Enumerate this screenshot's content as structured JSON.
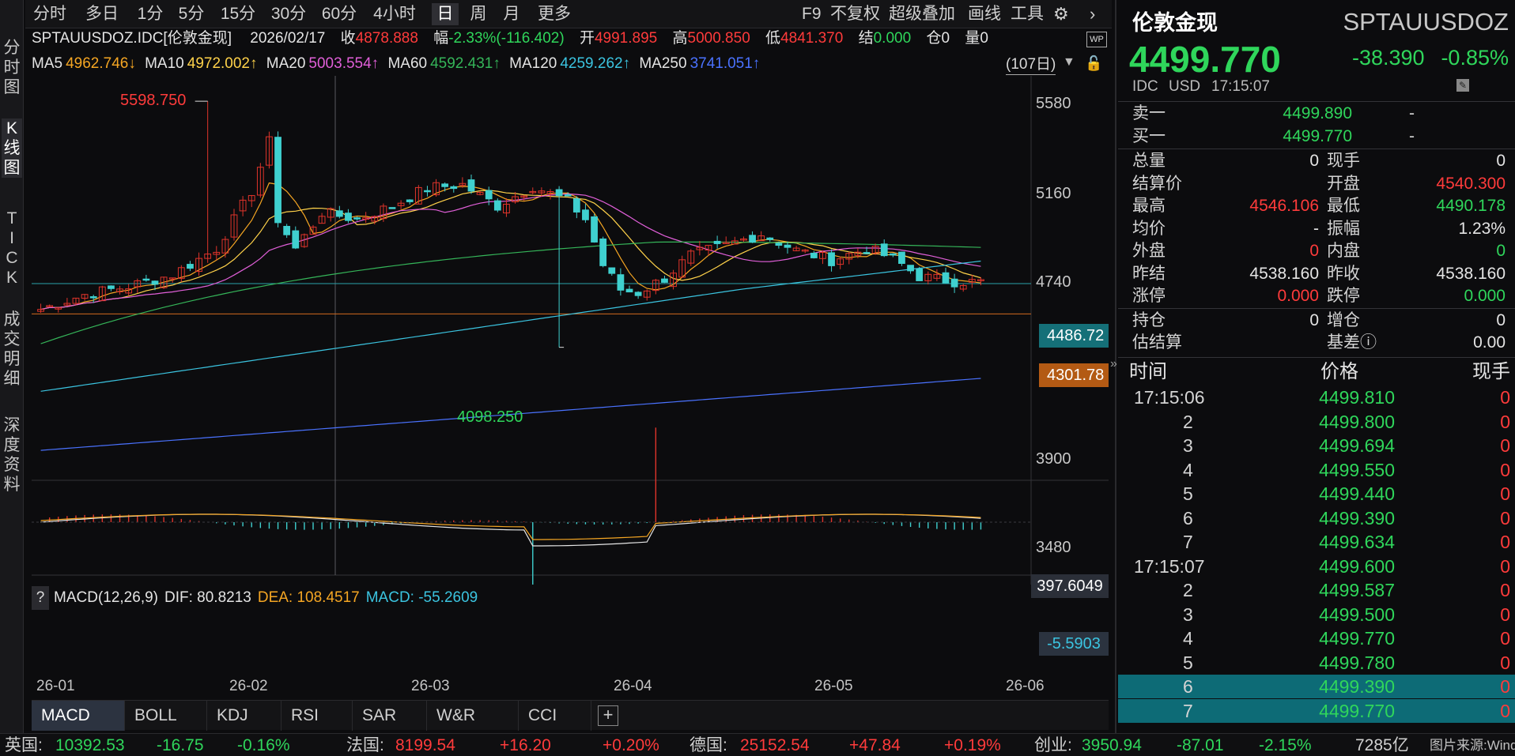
{
  "left_tabs": [
    "分\n时\n图",
    "K\n线\n图",
    "T\nI\nC\nK",
    "成\n交\n明\n细",
    "深\n度\n资\n料"
  ],
  "toolbar": {
    "periods": [
      "分时",
      "多日",
      "1分",
      "5分",
      "15分",
      "30分",
      "60分",
      "4小时",
      "日",
      "周",
      "月",
      "更多"
    ],
    "active_period": "日",
    "right": [
      "F9",
      "不复权",
      "超级叠加",
      "画线",
      "工具"
    ]
  },
  "info": {
    "symbol": "SPTAUUSDOZ.IDC[伦敦金现]",
    "date": "2026/02/17",
    "close_label": "收",
    "close": "4878.888",
    "chg_label": "幅",
    "chg": "-2.33%(-116.402)",
    "open_label": "开",
    "open": "4991.895",
    "high_label": "高",
    "high": "5000.850",
    "low_label": "低",
    "low": "4841.370",
    "settle_label": "结",
    "settle": "0.000",
    "oi_label": "仓",
    "oi": "0",
    "vol_label": "量",
    "vol": "0",
    "ma5": "MA5",
    "ma5_val": "4962.746↓",
    "ma10": "MA10",
    "ma10_val": "4972.002↑",
    "ma20": "MA20",
    "ma20_val": "5003.554↑",
    "ma60": "MA60",
    "ma60_val": "4592.431↑",
    "ma120": "MA120",
    "ma120_val": "4259.262↑",
    "ma250": "MA250",
    "ma250_val": "3741.051↑",
    "days": "(107日)"
  },
  "price_axis": [
    "5580",
    "5160",
    "4740",
    "3900",
    "3480"
  ],
  "annotations": {
    "high": "5598.750",
    "low": "4098.250"
  },
  "price_tags": {
    "current": "4486.72",
    "line": "4301.78"
  },
  "macd": {
    "help": "?",
    "name": "MACD(12,26,9)",
    "dif": "DIF: 80.8213",
    "dea": "DEA: 108.4517",
    "macd": "MACD: -55.2609",
    "axis_top": "397.6049",
    "last": "-5.5903"
  },
  "x_dates": [
    "26-01",
    "26-02",
    "26-03",
    "26-04",
    "26-05",
    "26-06"
  ],
  "indicator_tabs": [
    "MACD",
    "BOLL",
    "KDJ",
    "RSI",
    "SAR",
    "W&R",
    "CCI"
  ],
  "ticker": [
    {
      "text": "英国:",
      "color": "#d0d0d0"
    },
    {
      "text": "10392.53",
      "color": "#2fd65b"
    },
    {
      "text": "-16.75",
      "color": "#2fd65b"
    },
    {
      "text": "-0.16%",
      "color": "#2fd65b"
    },
    {
      "text": "法国:",
      "color": "#d0d0d0"
    },
    {
      "text": "8199.54",
      "color": "#ff3b3b"
    },
    {
      "text": "+16.20",
      "color": "#ff3b3b"
    },
    {
      "text": "+0.20%",
      "color": "#ff3b3b"
    },
    {
      "text": "德国:",
      "color": "#d0d0d0"
    },
    {
      "text": "25152.54",
      "color": "#ff3b3b"
    },
    {
      "text": "+47.84",
      "color": "#ff3b3b"
    },
    {
      "text": "+0.19%",
      "color": "#ff3b3b"
    },
    {
      "text": "创业:",
      "color": "#d0d0d0"
    },
    {
      "text": "3950.94",
      "color": "#2fd65b"
    },
    {
      "text": "-87.01",
      "color": "#2fd65b"
    },
    {
      "text": "-2.15%",
      "color": "#2fd65b"
    },
    {
      "text": "7285亿",
      "color": "#d0d0d0"
    },
    {
      "text": "图片来源:Wind",
      "color": "#c0c0c0"
    }
  ],
  "quote": {
    "name": "伦敦金现",
    "code": "SPTAUUSDOZ",
    "price": "4499.770",
    "chg": "-38.390",
    "pct": "-0.85%",
    "source": "IDC",
    "currency": "USD",
    "time": "17:15:07",
    "ask_label": "卖一",
    "ask": "4499.890",
    "ask_vol": "-",
    "bid_label": "买一",
    "bid": "4499.770",
    "bid_vol": "-",
    "left_labels": [
      "总量",
      "结算价",
      "最高",
      "均价",
      "外盘",
      "昨结",
      "涨停"
    ],
    "left_values": [
      "0",
      "",
      "4546.106",
      "-",
      "0",
      "4538.160",
      "0.000"
    ],
    "left_colors": [
      "#e4e4e4",
      "#e4e4e4",
      "#ff3b3b",
      "#e4e4e4",
      "#ff3b3b",
      "#e4e4e4",
      "#ff3b3b"
    ],
    "right_labels": [
      "现手",
      "开盘",
      "最低",
      "振幅",
      "内盘",
      "昨收",
      "跌停"
    ],
    "right_values": [
      "0",
      "4540.300",
      "4490.178",
      "1.23%",
      "0",
      "4538.160",
      "0.000"
    ],
    "right_colors": [
      "#e4e4e4",
      "#ff3b3b",
      "#2fd65b",
      "#e4e4e4",
      "#2fd65b",
      "#e4e4e4",
      "#2fd65b"
    ],
    "oi_label": "持仓",
    "oi": "0",
    "oi_chg_label": "增仓",
    "oi_chg": "0",
    "est_label": "估结算",
    "basis_label": "基差ⓘ",
    "basis": "0.00"
  },
  "trades_header": {
    "time": "时间",
    "price": "价格",
    "qty": "现手"
  },
  "trades": [
    {
      "t": "17:15:06",
      "p": "4499.810",
      "q": "0"
    },
    {
      "t": "2",
      "p": "4499.800",
      "q": "0"
    },
    {
      "t": "3",
      "p": "4499.694",
      "q": "0"
    },
    {
      "t": "4",
      "p": "4499.550",
      "q": "0"
    },
    {
      "t": "5",
      "p": "4499.440",
      "q": "0"
    },
    {
      "t": "6",
      "p": "4499.390",
      "q": "0"
    },
    {
      "t": "7",
      "p": "4499.634",
      "q": "0"
    },
    {
      "t": "17:15:07",
      "p": "4499.600",
      "q": "0"
    },
    {
      "t": "2",
      "p": "4499.587",
      "q": "0"
    },
    {
      "t": "3",
      "p": "4499.500",
      "q": "0"
    },
    {
      "t": "4",
      "p": "4499.770",
      "q": "0"
    },
    {
      "t": "5",
      "p": "4499.780",
      "q": "0"
    },
    {
      "t": "6",
      "p": "4499.390",
      "q": "0"
    },
    {
      "t": "7",
      "p": "4499.770",
      "q": "0"
    }
  ]
}
